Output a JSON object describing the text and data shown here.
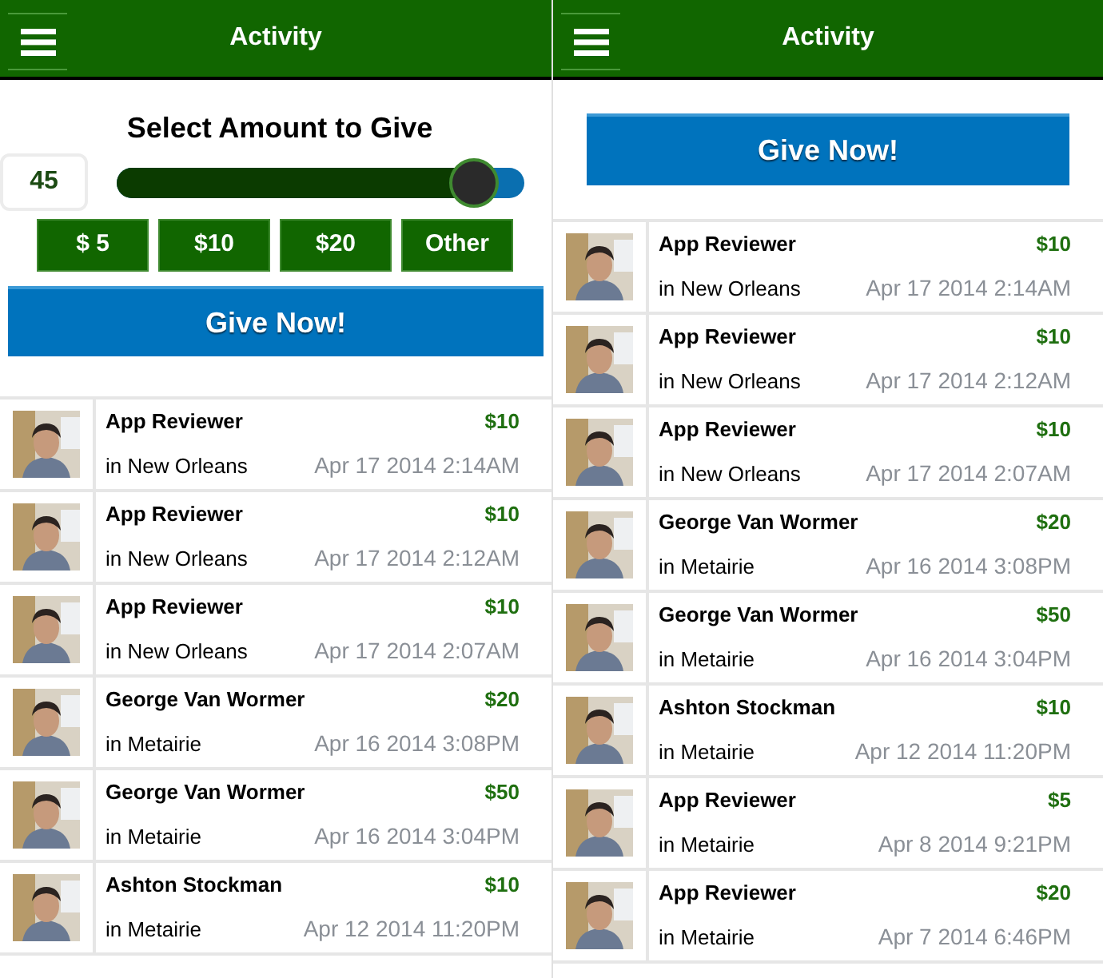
{
  "left_screen": {
    "header": {
      "title": "Activity"
    },
    "amount_heading": "Select Amount to Give",
    "amount_value": "45",
    "slider": {
      "level": 0.88
    },
    "preset_buttons": [
      "$ 5",
      "$10",
      "$20",
      "Other"
    ],
    "give_button": "Give Now!",
    "activities": [
      {
        "name": "App Reviewer",
        "location": "in New Orleans",
        "amount": "$10",
        "date": "Apr 17 2014 2:14AM"
      },
      {
        "name": "App Reviewer",
        "location": "in New Orleans",
        "amount": "$10",
        "date": "Apr 17 2014 2:12AM"
      },
      {
        "name": "App Reviewer",
        "location": "in New Orleans",
        "amount": "$10",
        "date": "Apr 17 2014 2:07AM"
      },
      {
        "name": "George Van Wormer",
        "location": "in Metairie",
        "amount": "$20",
        "date": "Apr 16 2014 3:08PM"
      },
      {
        "name": "George Van Wormer",
        "location": "in Metairie",
        "amount": "$50",
        "date": "Apr 16 2014 3:04PM"
      },
      {
        "name": "Ashton Stockman",
        "location": "in Metairie",
        "amount": "$10",
        "date": "Apr 12 2014 11:20PM"
      }
    ]
  },
  "right_screen": {
    "header": {
      "title": "Activity"
    },
    "give_button": "Give Now!",
    "activities": [
      {
        "name": "App Reviewer",
        "location": "in New Orleans",
        "amount": "$10",
        "date": "Apr 17 2014 2:14AM"
      },
      {
        "name": "App Reviewer",
        "location": "in New Orleans",
        "amount": "$10",
        "date": "Apr 17 2014 2:12AM"
      },
      {
        "name": "App Reviewer",
        "location": "in New Orleans",
        "amount": "$10",
        "date": "Apr 17 2014 2:07AM"
      },
      {
        "name": "George Van Wormer",
        "location": "in Metairie",
        "amount": "$20",
        "date": "Apr 16 2014 3:08PM"
      },
      {
        "name": "George Van Wormer",
        "location": "in Metairie",
        "amount": "$50",
        "date": "Apr 16 2014 3:04PM"
      },
      {
        "name": "Ashton Stockman",
        "location": "in Metairie",
        "amount": "$10",
        "date": "Apr 12 2014 11:20PM"
      },
      {
        "name": "App Reviewer",
        "location": "in Metairie",
        "amount": "$5",
        "date": "Apr 8 2014 9:21PM"
      },
      {
        "name": "App Reviewer",
        "location": "in Metairie",
        "amount": "$20",
        "date": "Apr 7 2014 6:46PM"
      }
    ]
  }
}
